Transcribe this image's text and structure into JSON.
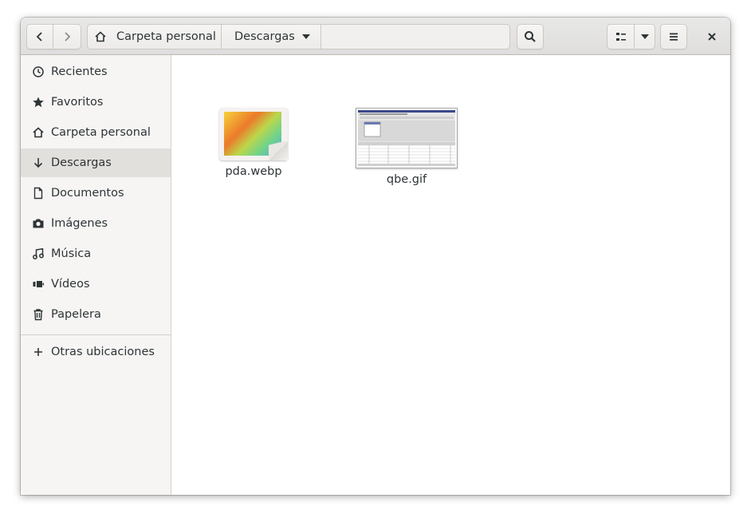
{
  "window": {
    "location": "Descargas"
  },
  "headerbar": {
    "back_icon": "go-previous-icon",
    "forward_icon": "go-next-icon",
    "path": [
      {
        "label": "Carpeta personal",
        "icon": "home-icon"
      },
      {
        "label": "Descargas",
        "icon": "pan-down-icon"
      }
    ],
    "search_icon": "search-icon",
    "view_icon": "list-view-icon",
    "view_dropdown_icon": "pan-down-icon",
    "menu_icon": "hamburger-menu-icon",
    "close_icon": "close-icon"
  },
  "sidebar": {
    "items": [
      {
        "label": "Recientes",
        "icon": "clock-icon",
        "selected": false
      },
      {
        "label": "Favoritos",
        "icon": "star-icon",
        "selected": false
      },
      {
        "label": "Carpeta personal",
        "icon": "home-icon",
        "selected": false
      },
      {
        "label": "Descargas",
        "icon": "download-arrow-icon",
        "selected": true
      },
      {
        "label": "Documentos",
        "icon": "document-icon",
        "selected": false
      },
      {
        "label": "Imágenes",
        "icon": "camera-icon",
        "selected": false
      },
      {
        "label": "Música",
        "icon": "music-note-icon",
        "selected": false
      },
      {
        "label": "Vídeos",
        "icon": "video-icon",
        "selected": false
      },
      {
        "label": "Papelera",
        "icon": "trash-icon",
        "selected": false
      }
    ],
    "other": {
      "label": "Otras ubicaciones",
      "icon": "plus-icon"
    }
  },
  "files": [
    {
      "name": "pda.webp",
      "thumbnail": "gradient-image"
    },
    {
      "name": "qbe.gif",
      "thumbnail": "screenshot-image"
    }
  ],
  "colors": {
    "text": "#2e3436",
    "selected_bg": "#e2e0dd",
    "sidebar_bg": "#f6f5f4",
    "headerbar_bg": "#e8e8e7"
  }
}
